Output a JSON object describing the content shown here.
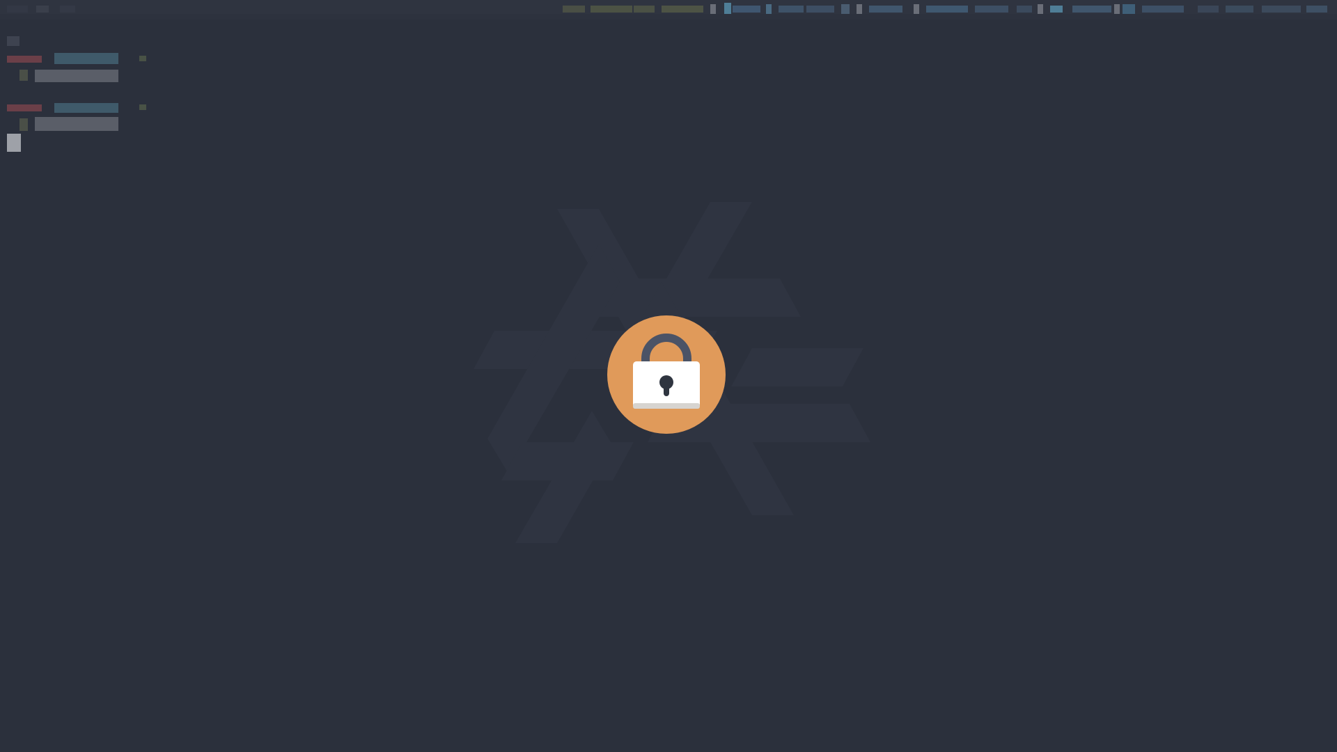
{
  "screen": {
    "state": "locked",
    "background_color": "#2b303c"
  },
  "lock_indicator": {
    "icon": "padlock-icon",
    "ring_color": "#e09a5a",
    "shackle_color": "#4b5366",
    "body_color": "#ffffff",
    "keyhole_color": "#2f3540"
  },
  "background_logo": {
    "icon": "nixos-snowflake-icon",
    "color": "#2f3441"
  }
}
